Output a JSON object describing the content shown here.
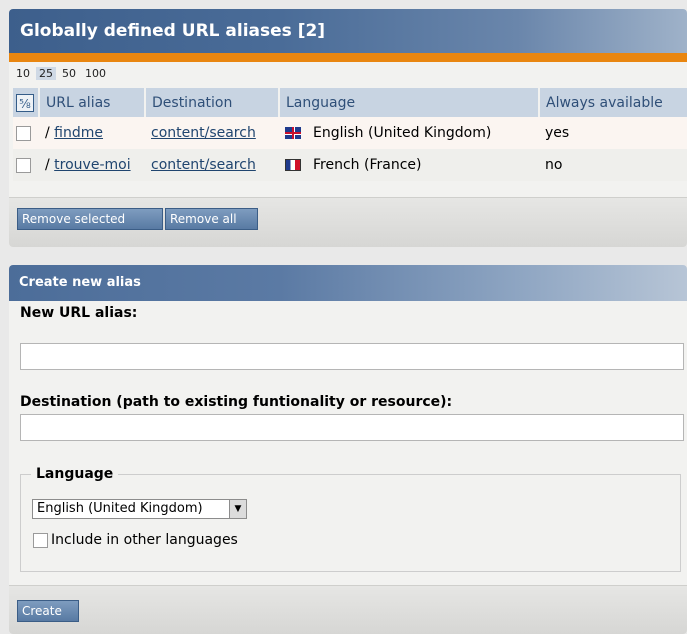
{
  "aliases_panel": {
    "title": "Globally defined URL aliases [2]",
    "pager": [
      "10",
      "25",
      "50",
      "100"
    ],
    "pager_active": "25",
    "columns": [
      "URL alias",
      "Destination",
      "Language",
      "Always available"
    ],
    "toggle_glyph": "⅝",
    "rows": [
      {
        "prefix": "/",
        "alias": "findme",
        "destination": "content/search",
        "flag": "uk-flag-icon",
        "language": "English (United Kingdom)",
        "always": "yes"
      },
      {
        "prefix": "/",
        "alias": "trouve-moi",
        "destination": "content/search",
        "flag": "france-flag-icon",
        "language": "French (France)",
        "always": "no"
      }
    ],
    "remove_selected_label": "Remove selected",
    "remove_all_label": "Remove all"
  },
  "create_panel": {
    "title": "Create new alias",
    "new_alias_label": "New URL alias:",
    "new_alias_value": "",
    "destination_label": "Destination (path to existing funtionality or resource):",
    "destination_value": "",
    "language_legend": "Language",
    "language_selected": "English (United Kingdom)",
    "include_label": "Include in other languages",
    "create_label": "Create"
  }
}
